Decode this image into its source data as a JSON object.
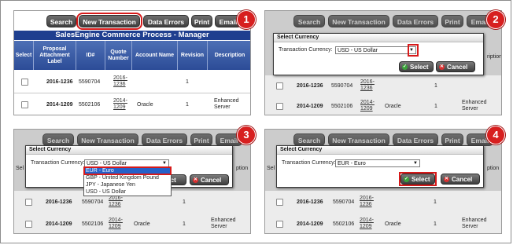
{
  "toolbar": {
    "search": "Search",
    "new_transaction": "New Transaction",
    "data_errors": "Data Errors",
    "print": "Print",
    "email": "Email"
  },
  "title": "SalesEngine Commerce Process - Manager",
  "columns": {
    "select": "Select",
    "proposal": "Proposal Attachment Label",
    "id": "ID#",
    "quote": "Quote Number",
    "account": "Account Name",
    "revision": "Revision",
    "description": "Description"
  },
  "rows": [
    {
      "label": "2016-1236",
      "id": "5590704",
      "quote": "2016-1236",
      "account": "",
      "revision": "1",
      "description": ""
    },
    {
      "label": "2014-1209",
      "id": "5502106",
      "quote": "2014-1209",
      "account": "Oracle",
      "revision": "1",
      "description": "Enhanced Server"
    }
  ],
  "dialog": {
    "title": "Select Currency",
    "field_label": "Transaction Currency:",
    "value_initial": "USD - US Dollar",
    "value_final": "EUR - Euro",
    "select_label": "Select",
    "cancel_label": "Cancel"
  },
  "currency_options": [
    "EUR - Euro",
    "GBP - United Kingdom Pound",
    "JPY - Japanese Yen",
    "USD - US Dollar"
  ],
  "truncated": {
    "search": "Search",
    "new_transaction": "New Transaction",
    "data_errors": "Data Errors",
    "print": "Print",
    "email": "Email",
    "sel": "Sel",
    "ription": "ription",
    "ption": "ption",
    "lect": "lect"
  },
  "steps": [
    "1",
    "2",
    "3",
    "4"
  ],
  "colors": {
    "highlight": "#d61a1a",
    "header_blue": "#1f3f8f",
    "button_dark": "#3e3e3e",
    "step_red": "#d71f1f"
  }
}
